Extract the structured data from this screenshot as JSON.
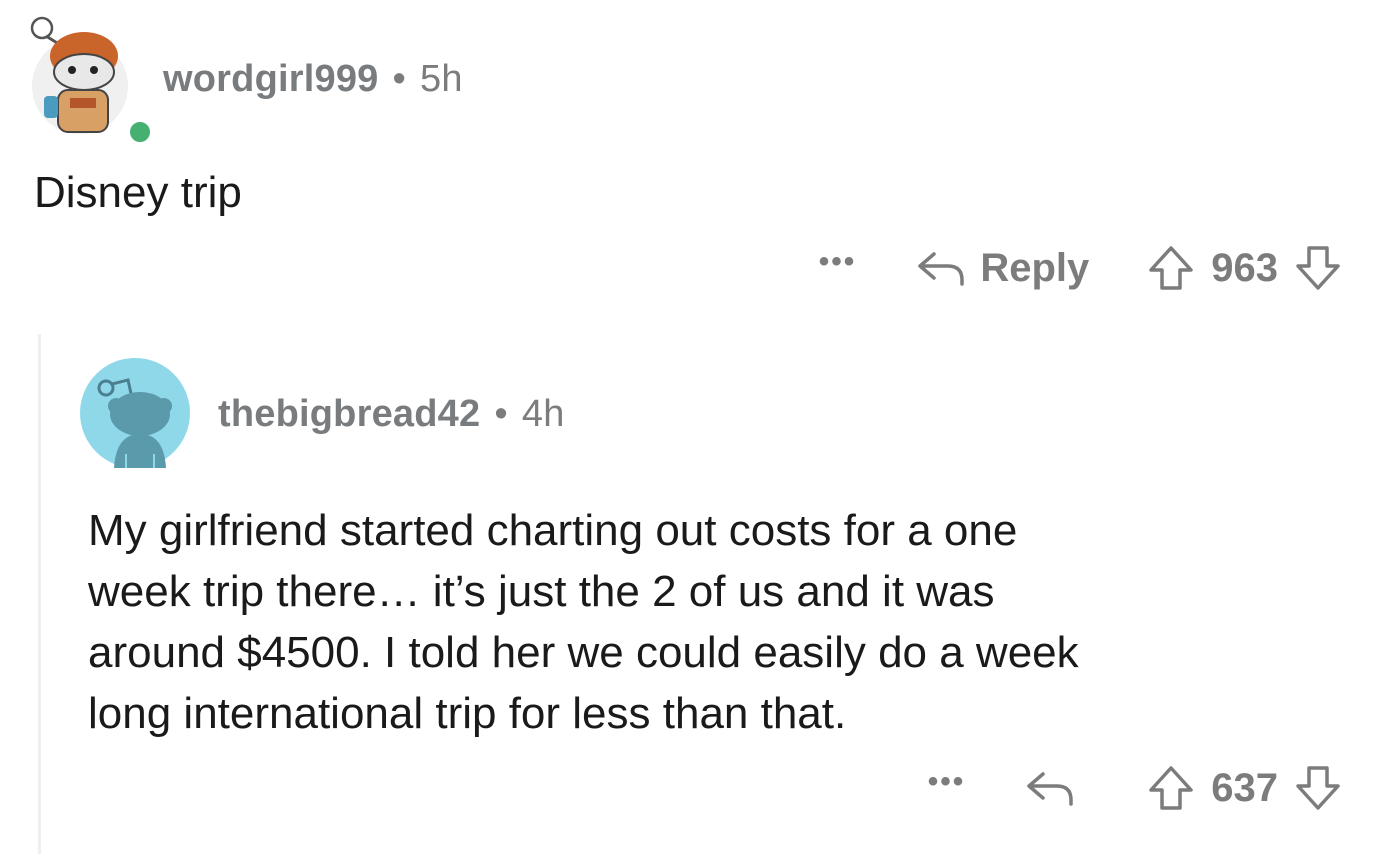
{
  "comments": [
    {
      "username": "wordgirl999",
      "separator": "•",
      "age": "5h",
      "body_lines": [
        "Disney trip"
      ],
      "more_label": "•••",
      "reply_label": "Reply",
      "score": "963",
      "avatar_icon": "snoo-avatar-icon",
      "online": true
    },
    {
      "username": "thebigbread42",
      "separator": "•",
      "age": "4h",
      "body_lines": [
        "My girlfriend started charting out costs for a one",
        "week trip there… it’s just the 2 of us and it was",
        "around $4500. I told her we could easily do a week",
        "long international trip for less than that."
      ],
      "more_label": "•••",
      "reply_label": "",
      "score": "637",
      "avatar_icon": "default-snoo-avatar-icon"
    }
  ],
  "colors": {
    "meta_text": "#7c7c7c",
    "body_text": "#1a1a1b",
    "online": "#46b070",
    "avatar_bg": "#8fd8ea",
    "thread_line": "#edeff1"
  }
}
